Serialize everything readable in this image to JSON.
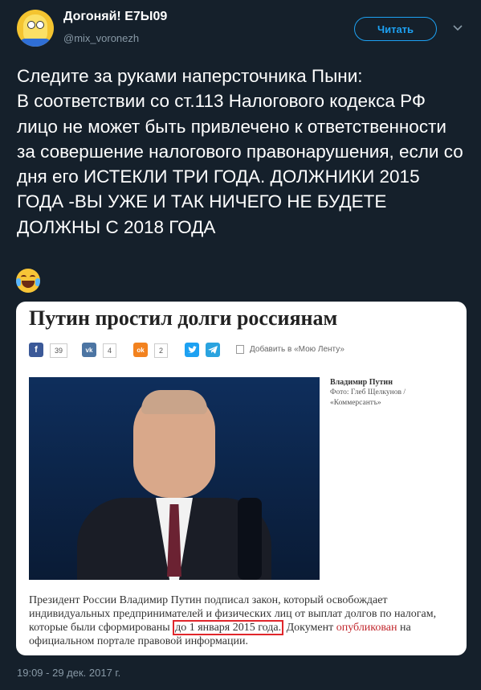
{
  "account": {
    "name": "Догоняй! Е7Ы09",
    "handle": "@mix_voronezh",
    "follow_label": "Читать"
  },
  "tweet": {
    "text": "Следите за руками наперсточника Пыни:\nВ соответствии со ст.113 Налогового кодекса РФ лицо не может быть привлечено к ответственности за совершение налогового правонарушения, если со дня его  ИСТЕКЛИ ТРИ ГОДА. ДОЛЖНИКИ 2015 ГОДА -ВЫ УЖЕ И ТАК НИЧЕГО НЕ БУДЕТЕ ДОЛЖНЫ С 2018 ГОДА",
    "emoji": "face-with-tears-of-joy",
    "timestamp": "19:09 - 29 дек. 2017 г."
  },
  "article": {
    "title": "Путин простил долги россиянам",
    "share": {
      "facebook_icon": "f",
      "facebook_count": "39",
      "vk_icon": "vk",
      "vk_count": "4",
      "ok_icon": "ok",
      "ok_count": "2",
      "twitter_icon": "twitter-bird",
      "telegram_icon": "telegram-plane",
      "favorites_label": "Добавить в «Мою Ленту»"
    },
    "photo_caption": {
      "name": "Владимир Путин",
      "credit": "Фото: Глеб Щелкунов / «Коммерсантъ»"
    },
    "body": {
      "part1": "Президент России Владимир Путин подписал закон, который освобождает индивидуальных предпринимателей и физических лиц от выплат долгов по налогам, которые были сформированы ",
      "highlight": "до 1 января 2015 года.",
      "part2": " Документ ",
      "link": "опубликован",
      "part3": " на официальном портале правовой информации."
    }
  },
  "colors": {
    "background": "#15202b",
    "accent": "#1da1f2",
    "muted": "#8899a6",
    "highlight_box": "#e0262b",
    "link": "#c1272d"
  }
}
